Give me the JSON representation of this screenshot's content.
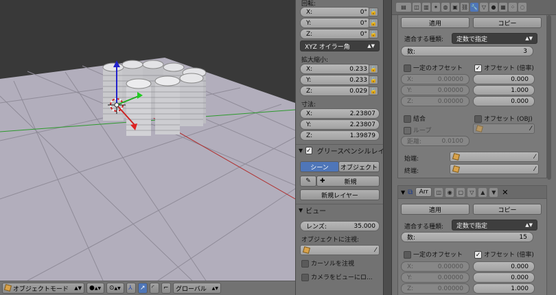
{
  "npanel": {
    "rotation_label": "回転:",
    "rot": {
      "x_label": "X:",
      "x_value": "0°",
      "y_label": "Y:",
      "y_value": "0°",
      "z_label": "Z:",
      "z_value": "0°"
    },
    "rotation_mode": "XYZ オイラー角",
    "scale_label": "拡大縮小:",
    "scale": {
      "x_label": "X:",
      "x_value": "0.233",
      "y_label": "Y:",
      "y_value": "0.233",
      "z_label": "Z:",
      "z_value": "0.029"
    },
    "dimensions_label": "寸法:",
    "dim": {
      "x_label": "X:",
      "x_value": "2.23807",
      "y_label": "Y:",
      "y_value": "2.23807",
      "z_label": "Z:",
      "z_value": "1.39879"
    },
    "grease_pencil_title": "グリースペンシルレイ",
    "scene_tab": "シーン",
    "object_tab": "オブジェクト",
    "new_label": "新規",
    "new_layer_label": "新規レイヤー",
    "view_title": "ビュー",
    "lens_label": "レンズ:",
    "lens_value": "35.000",
    "lock_to_object_label": "オブジェクトに注視:",
    "lock_cursor_label": "カーソルを注視",
    "lock_camera_label": "カメラをビューにロ..."
  },
  "header3d": {
    "mode": "オブジェクトモード",
    "orientation": "グローバル"
  },
  "modifier1": {
    "apply": "適用",
    "copy": "コピー",
    "fit_type_label": "適合する種類:",
    "fit_type_value": "定数で指定",
    "count_label": "数:",
    "count_value": "3",
    "constant_offset": "一定のオフセット",
    "relative_offset": "オフセット (倍率)",
    "const": {
      "x_label": "X:",
      "x_value": "0.00000",
      "y_label": "Y:",
      "y_value": "0.00000",
      "z_label": "Z:",
      "z_value": "0.00000"
    },
    "rel": {
      "x_value": "0.000",
      "y_value": "1.000",
      "z_value": "0.000"
    },
    "merge": "結合",
    "object_offset": "オフセット (OBJ)",
    "first_last": "ループ",
    "distance_label": "距離:",
    "distance_value": "0.0100",
    "start_cap": "始端:",
    "end_cap": "終端:"
  },
  "modifier2": {
    "name": "Arr",
    "apply": "適用",
    "copy": "コピー",
    "fit_type_label": "適合する種類:",
    "fit_type_value": "定数で指定",
    "count_label": "数:",
    "count_value": "15",
    "constant_offset": "一定のオフセット",
    "relative_offset": "オフセット (倍率)",
    "const": {
      "x_label": "X:",
      "x_value": "0.00000",
      "y_label": "Y:",
      "y_value": "0.00000",
      "z_label": "Z:",
      "z_value": "0.00000"
    },
    "rel": {
      "x_value": "0.000",
      "y_value": "0.000",
      "z_value": "1.000"
    }
  },
  "colors": {
    "accent": "#4f76b8",
    "viewport_bg": "#393939",
    "grid_plane": "#b2aebc",
    "panel": "#727272"
  }
}
